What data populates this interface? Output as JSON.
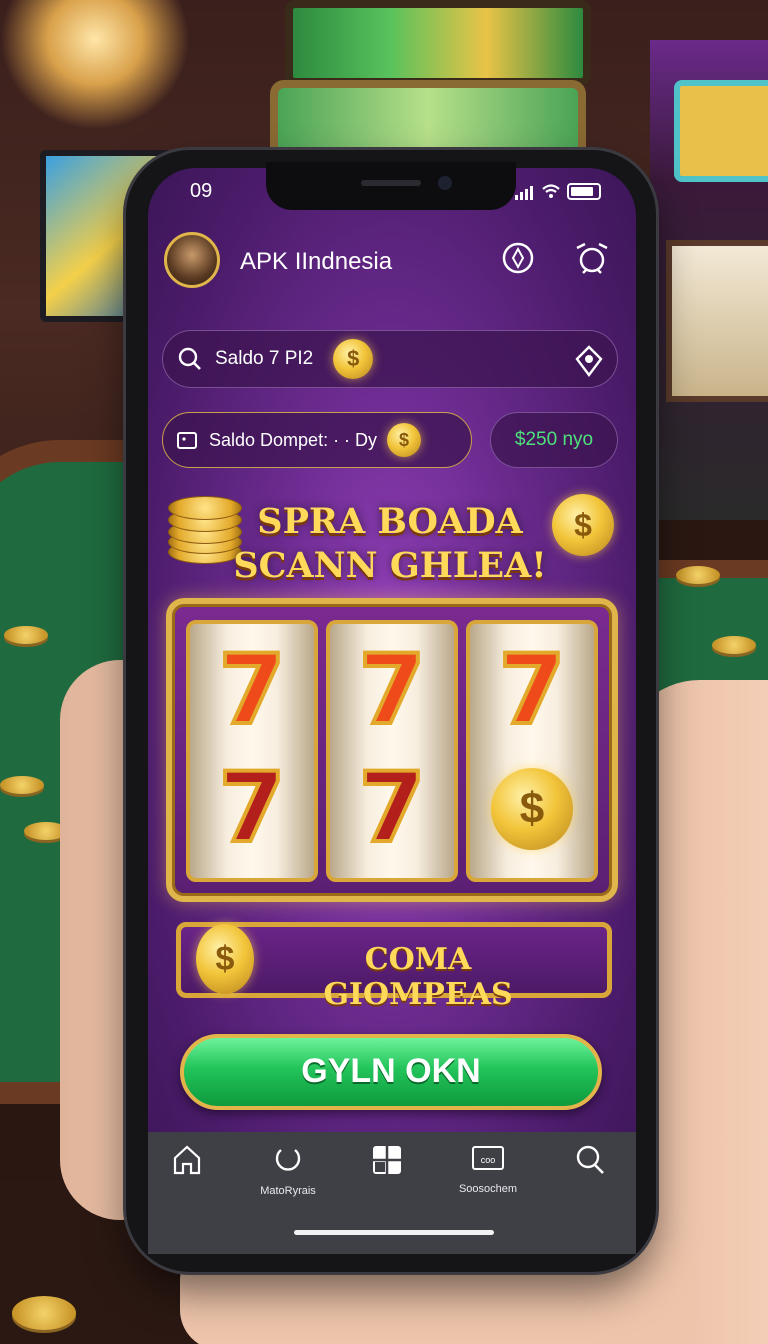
{
  "status_bar": {
    "time": "09"
  },
  "header": {
    "app_title": "APK IIndnesia",
    "avatar_icon": "avatar",
    "action_icons": [
      "compass-icon",
      "alarm-clock-icon"
    ]
  },
  "search_bar": {
    "text": "Saldo 7 PI2",
    "right_icon": "location-pin-icon"
  },
  "wallet": {
    "label": "Saldo Dompet: · · Dy",
    "balance": "$250 nyo"
  },
  "promo": {
    "line1": "SPRA BOADA",
    "line2": "SCANN GHLEA!"
  },
  "slot": {
    "top_row": [
      "7",
      "7",
      "7"
    ],
    "bottom_row": [
      "7",
      "7",
      "$"
    ]
  },
  "banner": {
    "text": "COMA GIOMPEAS"
  },
  "cta": {
    "label": "GYLN OKN"
  },
  "tabbar": {
    "tabs": [
      {
        "icon": "home-icon",
        "label": ""
      },
      {
        "icon": "refresh-icon",
        "label": "MatoRyrais"
      },
      {
        "icon": "grid-icon",
        "label": ""
      },
      {
        "icon": "ticket-icon",
        "label": "Soosochem"
      },
      {
        "icon": "search-icon",
        "label": ""
      }
    ]
  },
  "colors": {
    "accent_green": "#22c45a",
    "gold": "#e0b54a",
    "purple": "#6b2b8f"
  }
}
